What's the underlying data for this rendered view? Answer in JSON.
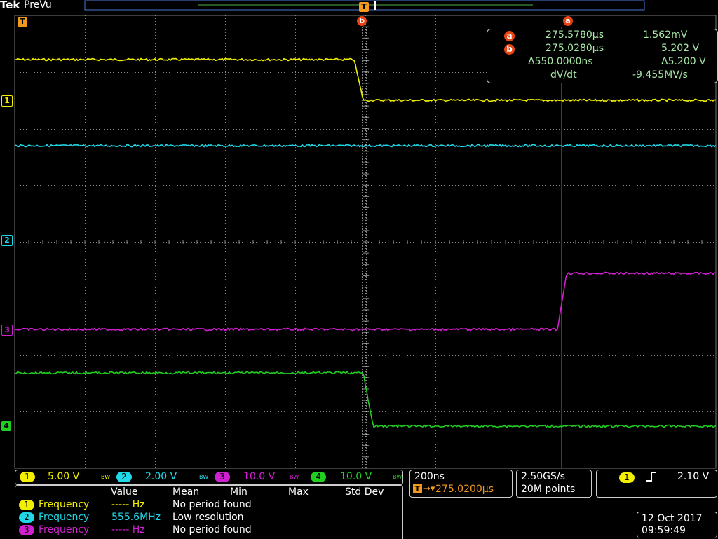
{
  "brand": "Tek",
  "mode": "PreVu",
  "colors": {
    "ch1": "#f2f000",
    "ch2": "#20d8e8",
    "ch3": "#d020d0",
    "ch4": "#20d020",
    "cursor": "#e84414",
    "trigger": "#f29a1c",
    "grid": "#7a7a7a"
  },
  "channel_markers": [
    "1",
    "2",
    "3",
    "4"
  ],
  "trigger_marker": "T",
  "cursors": {
    "a_label": "a",
    "b_label": "b",
    "a_time": "275.5780µs",
    "a_value": "1.562mV",
    "b_time": "275.0280µs",
    "b_value": "5.202 V",
    "delta_time": "Δ550.0000ns",
    "delta_value": "Δ5.200 V",
    "rate_label": "dV/dt",
    "rate_value": "-9.455MV/s"
  },
  "channels": [
    {
      "num": "1",
      "scale": "5.00 V",
      "bw": "BW"
    },
    {
      "num": "2",
      "scale": "2.00 V",
      "bw": "BW"
    },
    {
      "num": "3",
      "scale": "10.0 V",
      "bw": "BW"
    },
    {
      "num": "4",
      "scale": "10.0 V",
      "bw": "BW"
    }
  ],
  "timebase": {
    "scale": "200ns",
    "position": "275.0200µs",
    "trig_icon": "T"
  },
  "acquisition": {
    "rate": "2.50GS/s",
    "points": "20M points"
  },
  "trigger": {
    "source": "1",
    "slope": "rising-edge-icon",
    "level": "2.10 V"
  },
  "measurements": {
    "headers": [
      "Value",
      "Mean",
      "Min",
      "Max",
      "Std Dev"
    ],
    "rows": [
      {
        "ch": "1",
        "name": "Frequency",
        "value": "----- Hz",
        "mean": "No period found"
      },
      {
        "ch": "2",
        "name": "Frequency",
        "value": "555.6MHz",
        "mean": "Low resolution"
      },
      {
        "ch": "3",
        "name": "Frequency",
        "value": "----- Hz",
        "mean": "No period found"
      }
    ]
  },
  "date": "12 Oct  2017",
  "time": "09:59:49"
}
